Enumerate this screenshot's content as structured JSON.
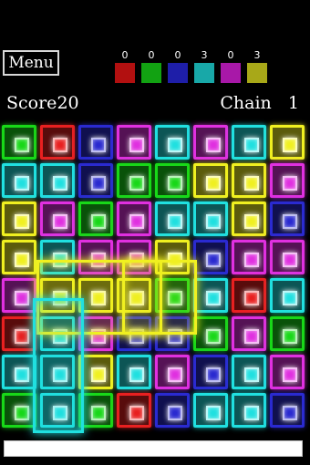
{
  "menu": {
    "label": "Menu"
  },
  "counters": [
    {
      "value": "0",
      "color": "#b21010"
    },
    {
      "value": "0",
      "color": "#12a212"
    },
    {
      "value": "0",
      "color": "#1e1ea8"
    },
    {
      "value": "3",
      "color": "#18a8a8"
    },
    {
      "value": "0",
      "color": "#a818a8"
    },
    {
      "value": "3",
      "color": "#a8a818"
    }
  ],
  "score": {
    "label": "Score",
    "value": "20"
  },
  "chain": {
    "label": "Chain",
    "value": "1"
  },
  "colors": {
    "G": "#18d818",
    "R": "#e82020",
    "B": "#2a2ad0",
    "M": "#e030e0",
    "C": "#20e0e0",
    "Y": "#f0f020"
  },
  "grid": [
    [
      "G",
      "R",
      "B",
      "M",
      "C",
      "M",
      "C",
      "Y"
    ],
    [
      "C",
      "C",
      "B",
      "G",
      "G",
      "Y",
      "Y",
      "M"
    ],
    [
      "Y",
      "M",
      "G",
      "M",
      "C",
      "C",
      "Y",
      "B"
    ],
    [
      "Y",
      "C",
      "M",
      "M",
      "Y",
      "B",
      "M",
      "M"
    ],
    [
      "M",
      "Y",
      "Y",
      "Y",
      "G",
      "C",
      "R",
      "C"
    ],
    [
      "R",
      "C",
      "M",
      "B",
      "B",
      "G",
      "M",
      "G"
    ],
    [
      "C",
      "C",
      "Y",
      "C",
      "M",
      "B",
      "C",
      "M"
    ],
    [
      "G",
      "C",
      "G",
      "R",
      "B",
      "C",
      "C",
      "B"
    ]
  ],
  "highlight_cells": [
    [
      4,
      1
    ],
    [
      4,
      2
    ],
    [
      4,
      3
    ],
    [
      3,
      4
    ],
    [
      5,
      1
    ],
    [
      6,
      1
    ],
    [
      7,
      1
    ]
  ],
  "progress": {
    "fraction": 1.0
  }
}
